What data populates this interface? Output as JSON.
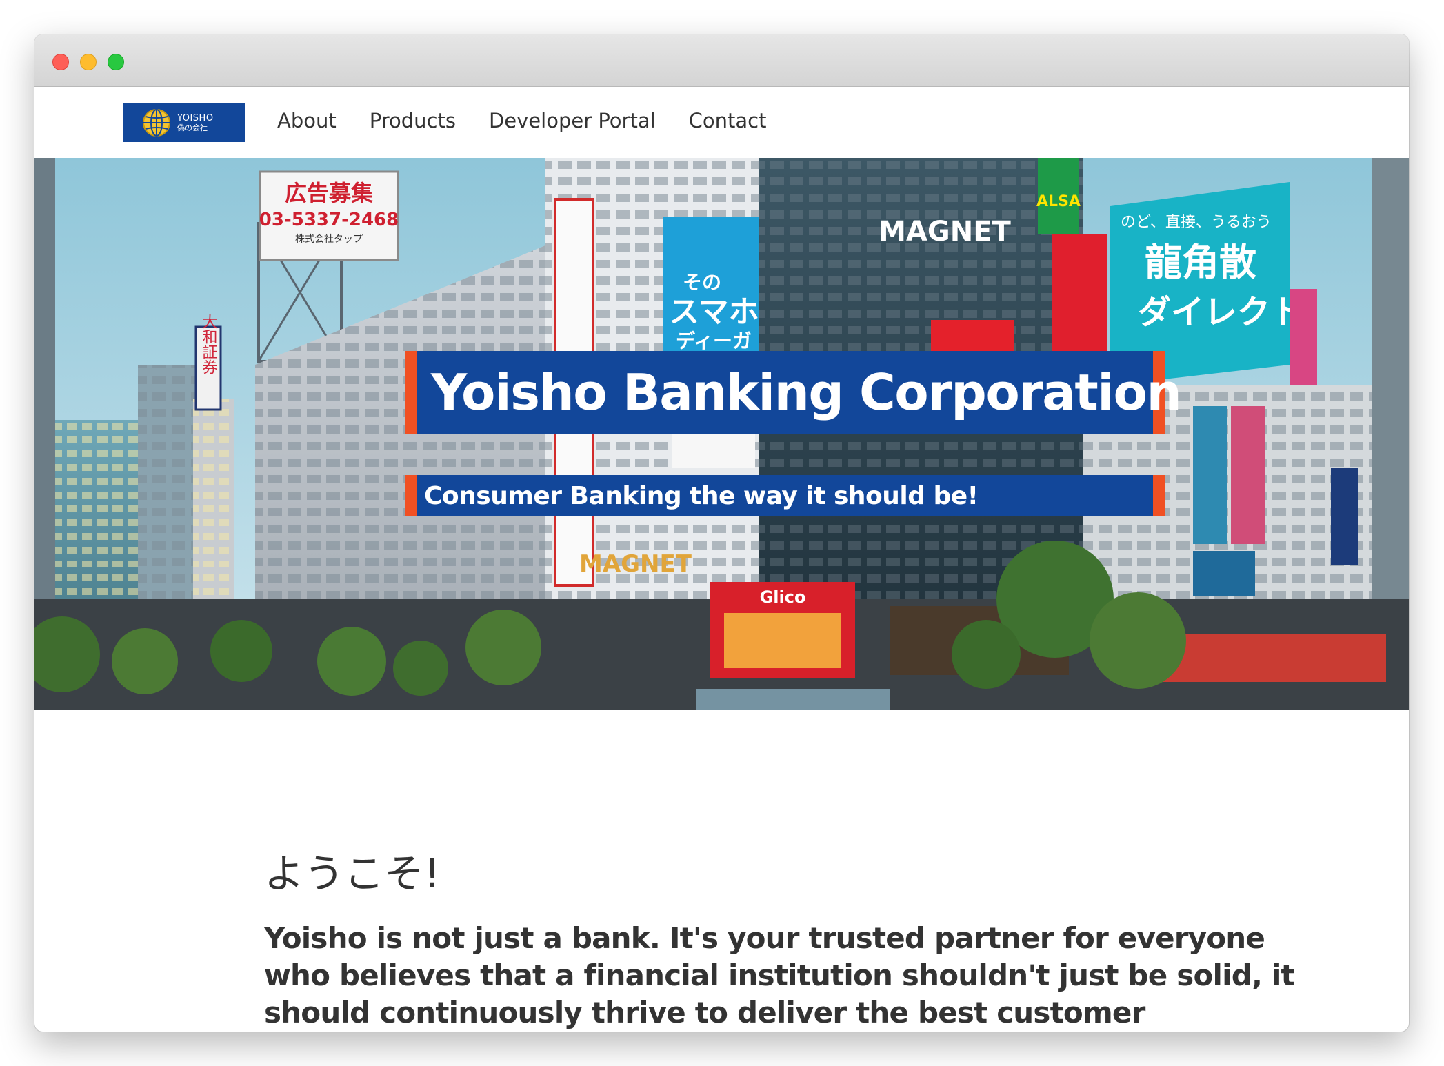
{
  "brand": {
    "name": "YOISHO",
    "subname": "偽の会社",
    "color": "#12479a",
    "accent": "#f05023"
  },
  "nav": {
    "items": [
      {
        "label": "About"
      },
      {
        "label": "Products"
      },
      {
        "label": "Developer Portal"
      },
      {
        "label": "Contact"
      }
    ]
  },
  "hero": {
    "title": "Yoisho Banking Corporation",
    "subtitle": "Consumer Banking the way it should be!",
    "signs": {
      "billboard_line1": "広告募集",
      "billboard_line2": "03-5337-2468",
      "billboard_line3": "株式会社タップ",
      "daiwa": "大和証券",
      "magnet_top": "MAGNET",
      "magnet_mid": "MAGNET",
      "sumaho_1": "その",
      "sumaho_2": "スマホ",
      "sumaho_3": "ディーガ",
      "ryukakusan_1": "龍角散",
      "ryukakusan_2": "ダイレクト",
      "ryukakusan_3": "のど、直接、うるおう",
      "alsa": "ALSA",
      "glico": "Glico"
    }
  },
  "content": {
    "welcome": "ようこそ!",
    "intro": "Yoisho is not just a bank. It's your trusted partner for everyone who believes that a financial institution shouldn't just be solid, it should continuously thrive to deliver the best customer experience, too. We"
  }
}
